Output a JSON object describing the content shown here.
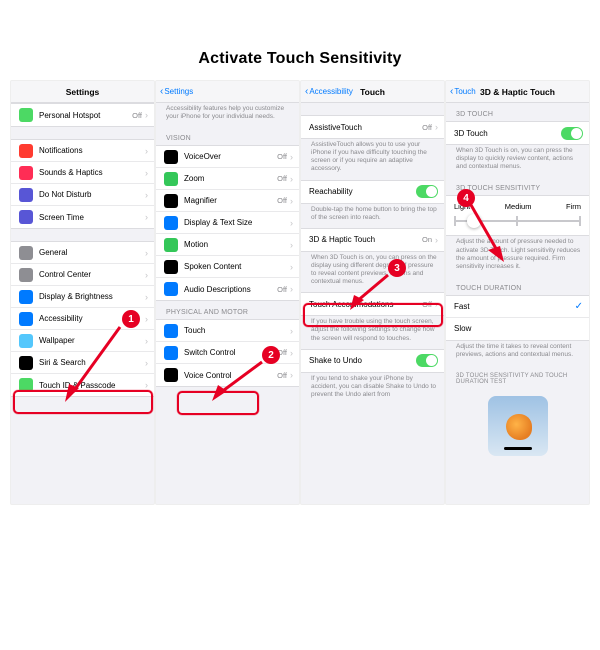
{
  "page_title": "Activate Touch Sensitivity",
  "steps": [
    "1",
    "2",
    "3",
    "4"
  ],
  "col1": {
    "header": "Settings",
    "rows": [
      {
        "icon": "#4cd964",
        "label": "Personal Hotspot",
        "value": "Off"
      },
      null,
      {
        "icon": "#ff3b30",
        "label": "Notifications"
      },
      {
        "icon": "#ff2d55",
        "label": "Sounds & Haptics"
      },
      {
        "icon": "#5856d6",
        "label": "Do Not Disturb"
      },
      {
        "icon": "#5856d6",
        "label": "Screen Time"
      },
      null,
      {
        "icon": "#8e8e93",
        "label": "General"
      },
      {
        "icon": "#8e8e93",
        "label": "Control Center"
      },
      {
        "icon": "#007aff",
        "label": "Display & Brightness"
      },
      {
        "icon": "#007aff",
        "label": "Accessibility",
        "hl": true
      },
      {
        "icon": "#54c7fc",
        "label": "Wallpaper"
      },
      {
        "icon": "#000",
        "label": "Siri & Search"
      },
      {
        "icon": "#4cd964",
        "label": "Touch ID & Passcode"
      }
    ]
  },
  "col2": {
    "back": "Settings",
    "desc_top": "Accessibility features help you customize your iPhone for your individual needs.",
    "grp1": "VISION",
    "vision": [
      {
        "icon": "#000",
        "label": "VoiceOver",
        "value": "Off"
      },
      {
        "icon": "#34c759",
        "label": "Zoom",
        "value": "Off"
      },
      {
        "icon": "#000",
        "label": "Magnifier",
        "value": "Off"
      },
      {
        "icon": "#007aff",
        "label": "Display & Text Size"
      },
      {
        "icon": "#34c759",
        "label": "Motion"
      },
      {
        "icon": "#000",
        "label": "Spoken Content"
      },
      {
        "icon": "#007aff",
        "label": "Audio Descriptions",
        "value": "Off"
      }
    ],
    "grp2": "PHYSICAL AND MOTOR",
    "motor": [
      {
        "icon": "#007aff",
        "label": "Touch",
        "hl": true
      },
      {
        "icon": "#007aff",
        "label": "Switch Control",
        "value": "Off"
      },
      {
        "icon": "#000",
        "label": "Voice Control",
        "value": "Off"
      }
    ]
  },
  "col3": {
    "back": "Accessibility",
    "title": "Touch",
    "s1": {
      "label": "AssistiveTouch",
      "value": "Off",
      "desc": "AssistiveTouch allows you to use your iPhone if you have difficulty touching the screen or if you require an adaptive accessory."
    },
    "s2": {
      "label": "Reachability",
      "toggle": true,
      "desc": "Double-tap the home button to bring the top of the screen into reach."
    },
    "s3": {
      "label": "3D & Haptic Touch",
      "value": "On",
      "hl": true,
      "desc": "When 3D Touch is on, you can press on the display using different degrees of pressure to reveal content previews, actions and contextual menus."
    },
    "s4": {
      "label": "Touch Accommodations",
      "value": "Off",
      "desc": "If you have trouble using the touch screen, adjust the following settings to change how the screen will respond to touches."
    },
    "s5": {
      "label": "Shake to Undo",
      "toggle": true,
      "desc": "If you tend to shake your iPhone by accident, you can disable Shake to Undo to prevent the Undo alert from"
    }
  },
  "col4": {
    "back": "Touch",
    "title": "3D & Haptic Touch",
    "g1": "3D TOUCH",
    "r1": {
      "label": "3D Touch",
      "toggle": true,
      "desc": "When 3D Touch is on, you can press the display to quickly review content, actions and contextual menus."
    },
    "g2": "3D TOUCH SENSITIVITY",
    "slider_labels": [
      "Light",
      "Medium",
      "Firm"
    ],
    "slider_desc": "Adjust the amount of pressure needed to activate 3D Touch. Light sensitivity reduces the amount of pressure required. Firm sensitivity increases it.",
    "g3": "TOUCH DURATION",
    "dur": [
      {
        "label": "Fast",
        "checked": true
      },
      {
        "label": "Slow"
      }
    ],
    "dur_desc": "Adjust the time it takes to reveal content previews, actions and contextual menus.",
    "g4": "3D TOUCH SENSITIVITY AND TOUCH DURATION TEST"
  }
}
